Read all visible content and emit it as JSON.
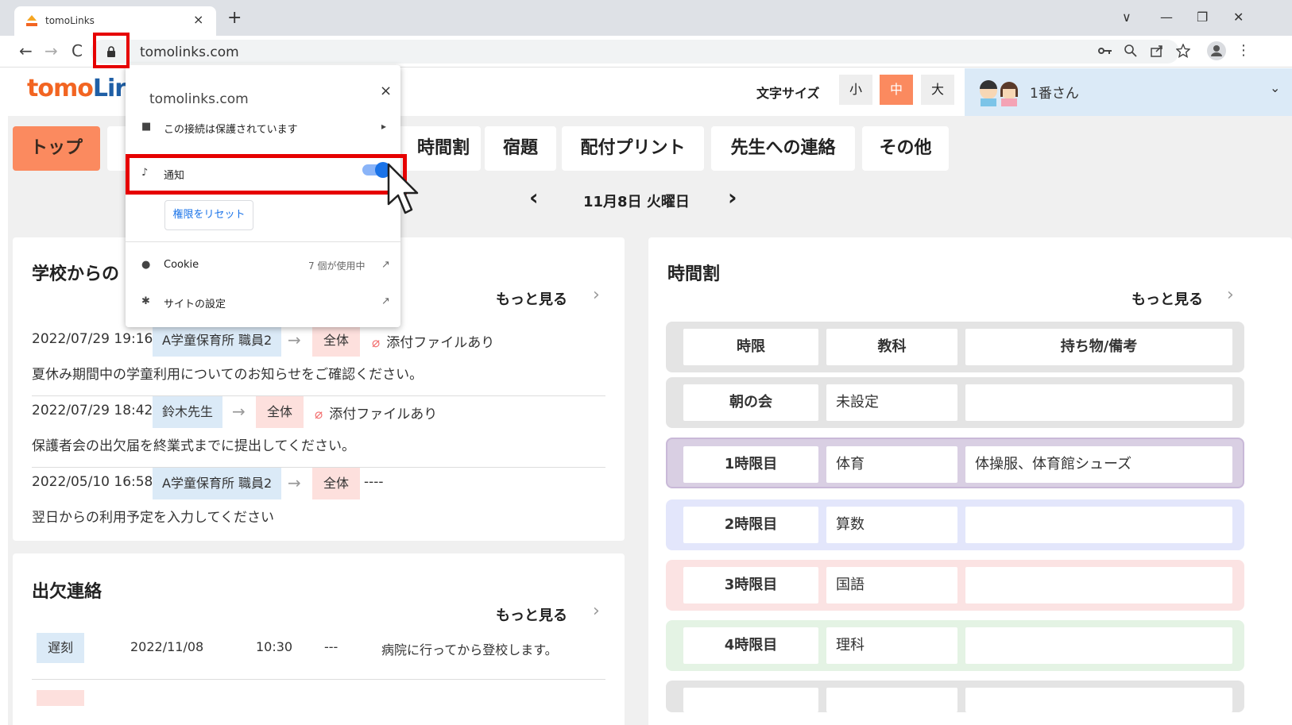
{
  "browser": {
    "tab_title": "tomoLinks",
    "tab_close": "×",
    "new_tab": "+",
    "window_controls": [
      "∨",
      "—",
      "❐",
      "✕"
    ],
    "nav": {
      "back": "←",
      "forward": "→",
      "reload": "C"
    },
    "url": "tomolinks.com",
    "lock_icon": "lock-icon"
  },
  "popup": {
    "domain": "tomolinks.com",
    "close": "×",
    "connection": "この接続は保護されています",
    "connection_chevron": "▸",
    "notification_label": "通知",
    "notification_enabled": true,
    "reset_button": "権限をリセット",
    "cookie_label": "Cookie",
    "cookie_count": "7 個が使用中",
    "site_settings": "サイトの設定"
  },
  "header": {
    "logo_orange": "tomo",
    "logo_blue": "Lir",
    "font_size_label": "文字サイズ",
    "font_sizes": [
      "小",
      "中",
      "大"
    ],
    "active_font_size": "中",
    "user_name": "1番さん",
    "user_chevron": "⌄"
  },
  "nav_tabs": [
    "トップ",
    "時間割",
    "宿題",
    "配付プリント",
    "先生への連絡",
    "その他"
  ],
  "date_nav": {
    "prev": "‹",
    "date": "11月8日 火曜日",
    "next": "›"
  },
  "news_card": {
    "title": "学校からの",
    "more": "もっと見る",
    "more_chevron": "›",
    "arrow": "→",
    "all_tag": "全体",
    "items": [
      {
        "datetime": "2022/07/29 19:16",
        "sender": "A学童保育所 職員2",
        "attachment": "添付ファイルあり",
        "body": "夏休み期間中の学童利用についてのお知らせをご確認ください。"
      },
      {
        "datetime": "2022/07/29 18:42",
        "sender": "鈴木先生",
        "attachment": "添付ファイルあり",
        "body": "保護者会の出欠届を終業式までに提出してください。"
      },
      {
        "datetime": "2022/05/10 16:58",
        "sender": "A学童保育所 職員2",
        "attachment": "----",
        "body": "翌日からの利用予定を入力してください"
      }
    ]
  },
  "attendance_card": {
    "title": "出欠連絡",
    "more": "もっと見る",
    "rows": [
      {
        "type": "遅刻",
        "date": "2022/11/08",
        "time": "10:30",
        "extra": "---",
        "note": "病院に行ってから登校します。"
      }
    ]
  },
  "timetable_card": {
    "title": "時間割",
    "more": "もっと見る",
    "headers": [
      "時限",
      "教科",
      "持ち物/備考"
    ],
    "rows": [
      {
        "period": "朝の会",
        "subject": "未設定",
        "notes": ""
      },
      {
        "period": "1時限目",
        "subject": "体育",
        "notes": "体操服、体育館シューズ"
      },
      {
        "period": "2時限目",
        "subject": "算数",
        "notes": ""
      },
      {
        "period": "3時限目",
        "subject": "国語",
        "notes": ""
      },
      {
        "period": "4時限目",
        "subject": "理科",
        "notes": ""
      }
    ]
  },
  "colors": {
    "accent": "#fb8a5f",
    "highlight": "#e60000",
    "toggle": "#1a73e8",
    "row_colors": [
      "#e4e4e4",
      "#d9cfe3",
      "#e3e6fb",
      "#fbe3e3",
      "#e4f3e4"
    ]
  }
}
